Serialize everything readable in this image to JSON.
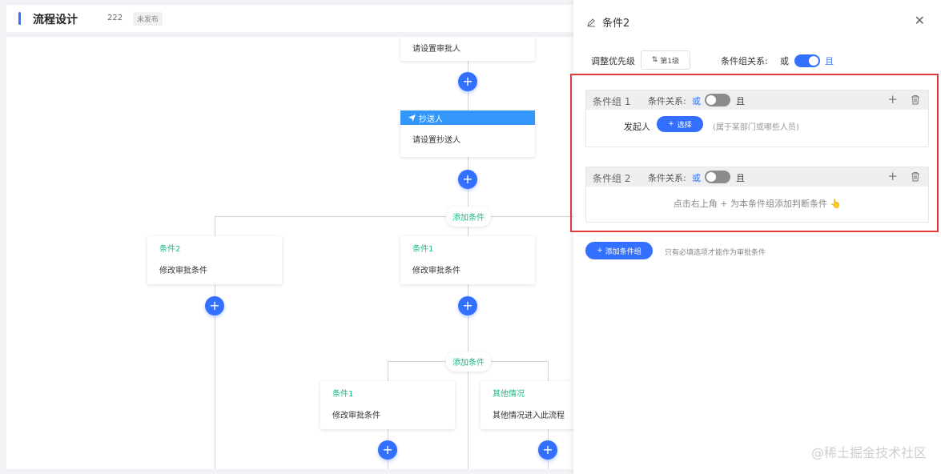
{
  "header": {
    "title": "流程设计",
    "version": "222",
    "status": "未发布"
  },
  "flow": {
    "approver_node": {
      "text": "请设置审批人"
    },
    "cc_node": {
      "label": "抄送人",
      "text": "请设置抄送人"
    },
    "add_condition_label": "添加条件",
    "add_icon": "+",
    "branches_level1": [
      {
        "title": "条件2",
        "text": "修改审批条件"
      },
      {
        "title": "条件1",
        "text": "修改审批条件"
      }
    ],
    "branches_level2": [
      {
        "title": "条件1",
        "text": "修改审批条件"
      },
      {
        "title": "其他情况",
        "text": "其他情况进入此流程"
      }
    ]
  },
  "drawer": {
    "title": "条件2",
    "close_icon": "✕",
    "priority_label": "调整优先级",
    "priority_value": "第1级",
    "group_relation_label": "条件组关系:",
    "relation_or": "或",
    "relation_and": "且",
    "group_relation_on": true,
    "groups": [
      {
        "title": "条件组 1",
        "relation_label": "条件关系:",
        "or": "或",
        "and": "且",
        "initiator_label": "发起人",
        "select_label": "选择",
        "select_hint": "(属于某部门或哪些人员)"
      },
      {
        "title": "条件组 2",
        "relation_label": "条件关系:",
        "or": "或",
        "and": "且",
        "empty_hint": "点击右上角 + 为本条件组添加判断条件 👆"
      }
    ],
    "plus_icon": "+",
    "add_group_label": "添加条件组",
    "add_group_hint": "只有必填选项才能作为审批条件"
  },
  "watermark": "@稀土掘金技术社区",
  "colors": {
    "primary": "#3370ff",
    "condition_green": "#15bc83",
    "cc_header": "#3296fa",
    "highlight": "#e03a3a"
  }
}
